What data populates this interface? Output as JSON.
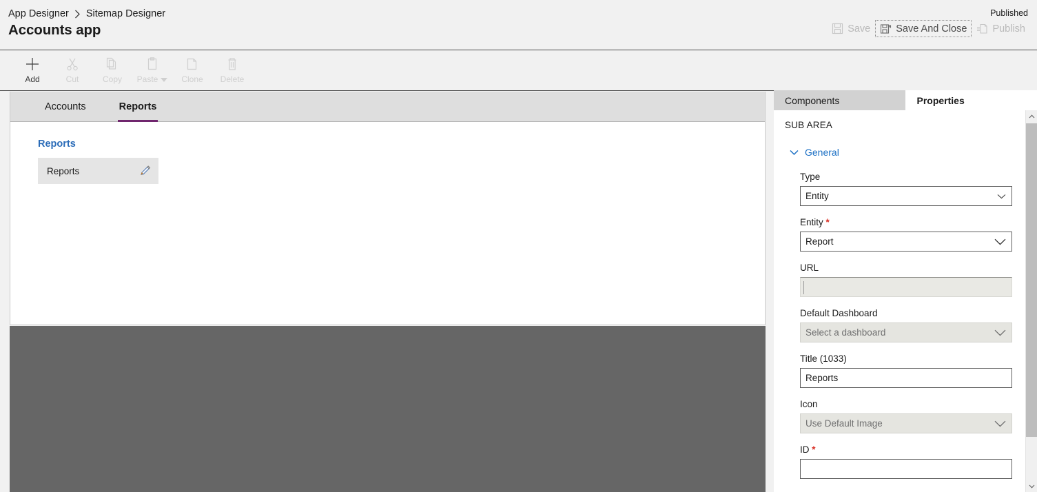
{
  "header": {
    "breadcrumb": {
      "parent": "App Designer",
      "separator_icon": "chevron-right-icon",
      "current": "Sitemap Designer"
    },
    "app_title": "Accounts app",
    "published_status": "Published",
    "commands": [
      {
        "label": "Save",
        "icon": "save-icon",
        "enabled": false,
        "focused": false
      },
      {
        "label": "Save And Close",
        "icon": "save-and-close-icon",
        "enabled": true,
        "focused": true
      },
      {
        "label": "Publish",
        "icon": "publish-icon",
        "enabled": false,
        "focused": false
      }
    ]
  },
  "toolbar": {
    "items": [
      {
        "label": "Add",
        "icon": "plus-icon",
        "enabled": true,
        "has_caret": false
      },
      {
        "label": "Cut",
        "icon": "scissors-icon",
        "enabled": false,
        "has_caret": false
      },
      {
        "label": "Copy",
        "icon": "copy-icon",
        "enabled": false,
        "has_caret": false
      },
      {
        "label": "Paste",
        "icon": "clipboard-icon",
        "enabled": false,
        "has_caret": true
      },
      {
        "label": "Clone",
        "icon": "clone-icon",
        "enabled": false,
        "has_caret": false
      },
      {
        "label": "Delete",
        "icon": "trash-icon",
        "enabled": false,
        "has_caret": false
      }
    ]
  },
  "canvas": {
    "tabs": [
      {
        "label": "Accounts",
        "active": false
      },
      {
        "label": "Reports",
        "active": true
      }
    ],
    "active_tab_underline_color": "#70266e",
    "group": {
      "title": "Reports",
      "title_color": "#2b6cb8",
      "subareas": [
        {
          "label": "Reports",
          "edit_icon": "pencil-icon"
        }
      ]
    }
  },
  "properties_panel": {
    "tabs": [
      {
        "label": "Components",
        "active": false
      },
      {
        "label": "Properties",
        "active": true
      }
    ],
    "section_heading": "SUB AREA",
    "collapsible": {
      "label": "General",
      "icon": "chevron-down-icon",
      "expanded": true,
      "color": "#1a6fc4"
    },
    "fields": [
      {
        "label": "Type",
        "required": false,
        "control": "select",
        "value": "Entity",
        "placeholder": "",
        "disabled": false,
        "name": "type-select"
      },
      {
        "label": "Entity",
        "required": true,
        "control": "select",
        "value": "Report",
        "placeholder": "",
        "disabled": false,
        "name": "entity-select"
      },
      {
        "label": "URL",
        "required": false,
        "control": "text",
        "value": "",
        "placeholder": "",
        "disabled": true,
        "name": "url-input"
      },
      {
        "label": "Default Dashboard",
        "required": false,
        "control": "select",
        "value": "Select a dashboard",
        "placeholder": "Select a dashboard",
        "disabled": true,
        "name": "default-dashboard-select"
      },
      {
        "label": "Title (1033)",
        "required": false,
        "control": "text",
        "value": "Reports",
        "placeholder": "",
        "disabled": false,
        "name": "title-input"
      },
      {
        "label": "Icon",
        "required": false,
        "control": "select",
        "value": "Use Default Image",
        "placeholder": "Use Default Image",
        "disabled": true,
        "name": "icon-select"
      },
      {
        "label": "ID",
        "required": true,
        "control": "text",
        "value": "",
        "placeholder": "",
        "disabled": false,
        "name": "id-input",
        "clipped": true
      }
    ],
    "scrollbar": {
      "up_icon": "chevron-up-icon",
      "down_icon": "chevron-down-icon"
    }
  },
  "colors": {
    "accent_purple": "#70266e",
    "link_blue": "#2b6cb8",
    "required_red": "#d93025",
    "overlay_grey": "#666666",
    "chrome_grey": "#f1f1f1"
  }
}
